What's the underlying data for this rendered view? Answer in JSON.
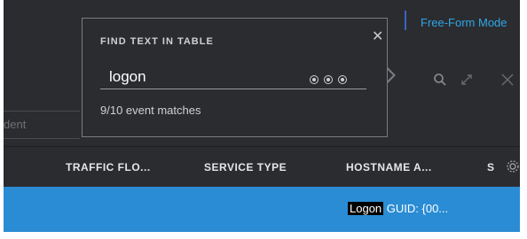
{
  "topbar": {
    "mode_link": "Free-Form Mode"
  },
  "filter": {
    "partial_text": "dent"
  },
  "find_panel": {
    "title": "FIND TEXT IN TABLE",
    "query": "logon",
    "match_summary": "9/10 event matches",
    "close_icon": "close-icon",
    "nav_icons": [
      "previous-match-icon",
      "next-match-icon",
      "clear-icon"
    ]
  },
  "toolbar_icons": [
    "search-icon",
    "expand-icon",
    "close-icon"
  ],
  "table": {
    "columns": [
      "TRAFFIC FLO...",
      "SERVICE TYPE",
      "HOSTNAME A...",
      "S"
    ],
    "settings_icon": "gear-icon",
    "selected_row": {
      "match_text": "Logon",
      "rest_text": " GUID: {00..."
    }
  },
  "colors": {
    "accent": "#2ea6e6",
    "selected_row": "#2a8cd4",
    "background": "#2b2c30"
  }
}
